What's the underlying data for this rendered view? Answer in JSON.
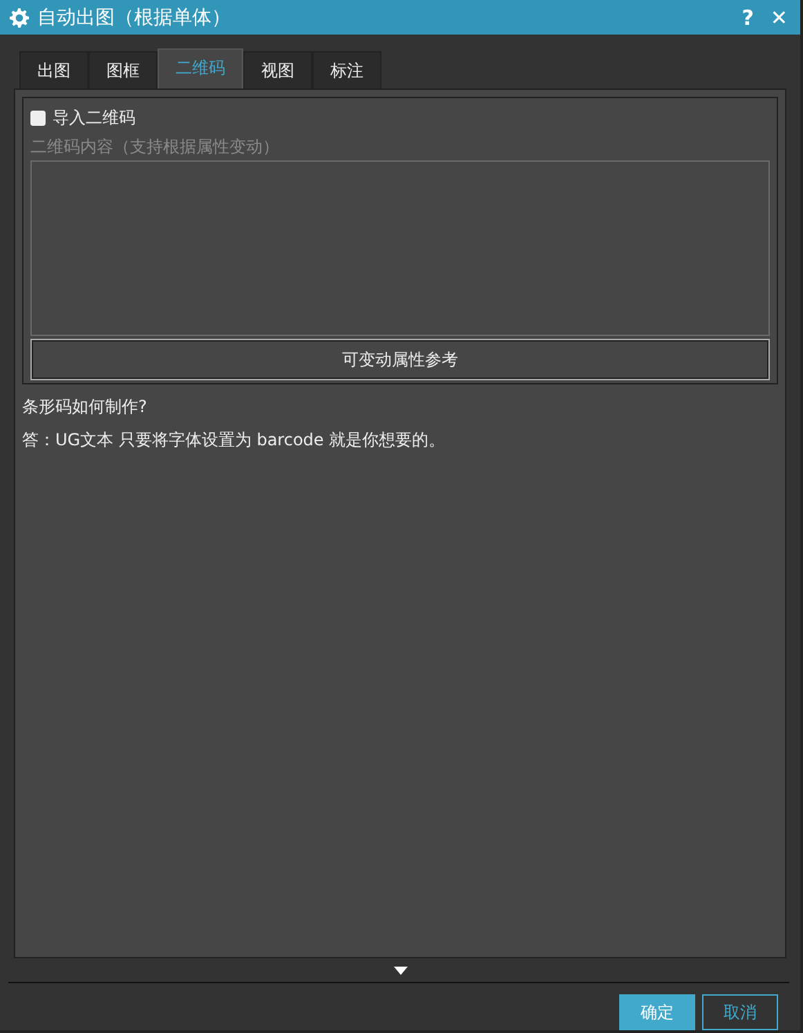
{
  "window": {
    "title": "自动出图（根据单体）",
    "help": "?",
    "close": "✕"
  },
  "tabs": [
    {
      "label": "出图",
      "selected": false
    },
    {
      "label": "图框",
      "selected": false
    },
    {
      "label": "二维码",
      "selected": true
    },
    {
      "label": "视图",
      "selected": false
    },
    {
      "label": "标注",
      "selected": false
    }
  ],
  "qr": {
    "import_label": "导入二维码",
    "checked": false,
    "content_label": "二维码内容（支持根据属性变动）",
    "reference_button": "可变动属性参考"
  },
  "notes": [
    "条形码如何制作?",
    "答：UG文本 只要将字体设置为 barcode 就是你想要的。"
  ],
  "buttons": [
    {
      "label": "确定",
      "kind": "primary"
    },
    {
      "label": "取消",
      "kind": "secondary"
    }
  ]
}
